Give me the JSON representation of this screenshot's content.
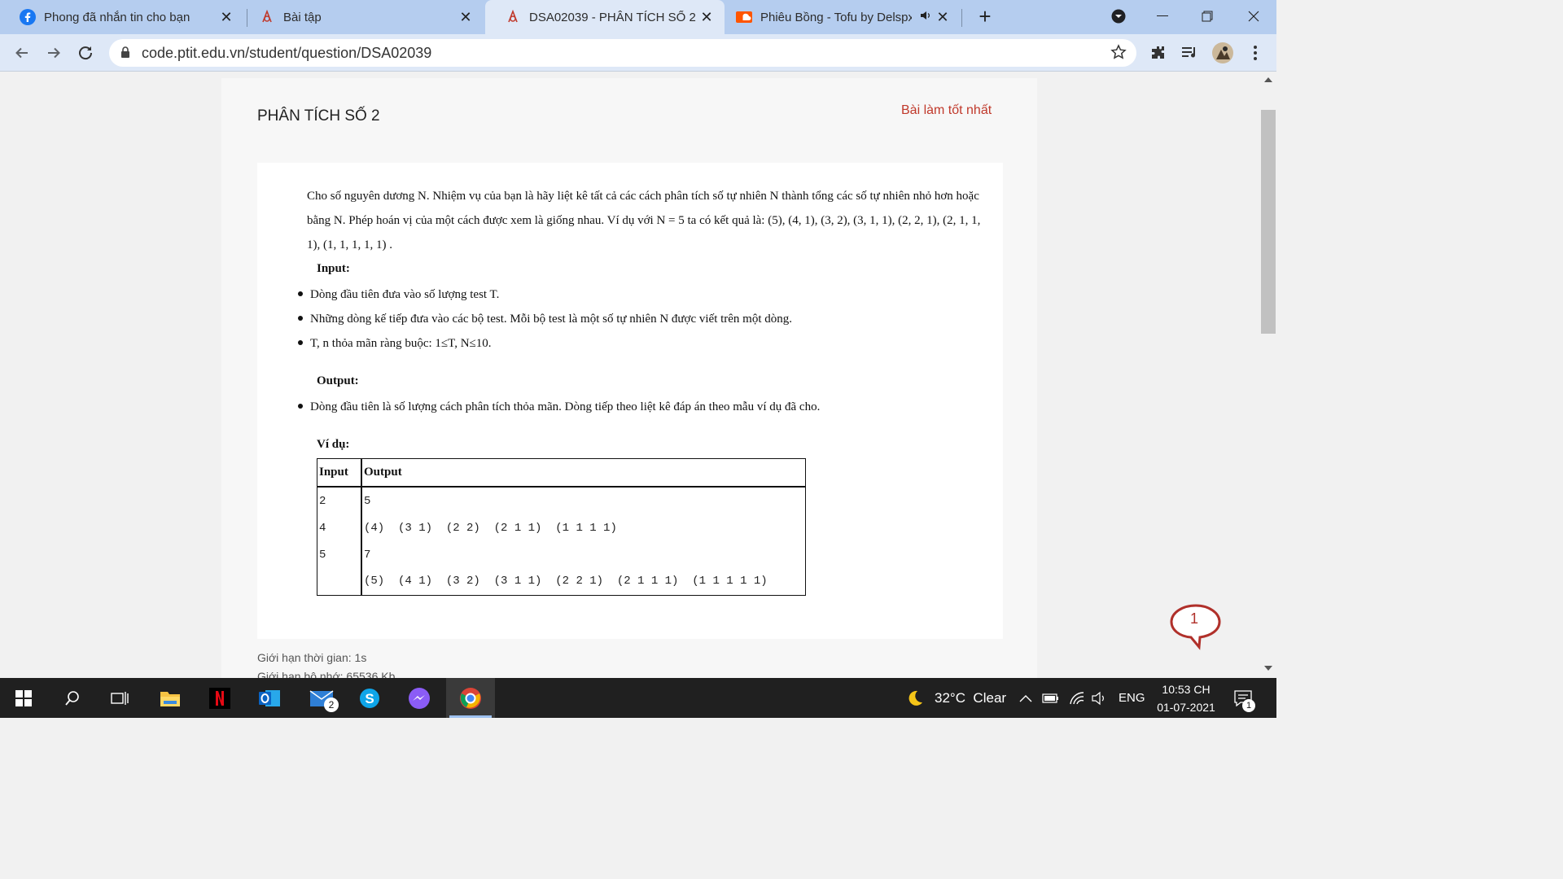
{
  "browser": {
    "tabs": [
      {
        "label": "Phong đã nhắn tin cho bạn",
        "icon": "facebook-icon"
      },
      {
        "label": "Bài tập",
        "icon": "ptit-code-icon"
      },
      {
        "label": "DSA02039 - PHÂN TÍCH SỐ 2",
        "icon": "ptit-code-icon"
      },
      {
        "label": "Phiêu Bồng - Tofu by Delspx",
        "icon": "soundcloud-icon"
      }
    ],
    "url": "code.ptit.edu.vn/student/question/DSA02039"
  },
  "problem": {
    "title": "PHÂN TÍCH SỐ 2",
    "best_link": "Bài làm tốt nhất",
    "description": "Cho số nguyên dương N. Nhiệm vụ của bạn là hãy liệt kê tất cả các cách phân tích số tự nhiên N thành tổng các số tự nhiên nhỏ hơn hoặc bằng N. Phép hoán vị của một cách được xem là giống nhau. Ví dụ với N = 5 ta có kết quả là: (5), (4, 1), (3, 2), (3, 1, 1), (2, 2, 1), (2, 1, 1, 1), (1, 1, 1, 1, 1) .",
    "input_heading": "Input:",
    "input_items": [
      "Dòng đầu tiên đưa vào số lượng test T.",
      "Những dòng kế tiếp đưa vào các bộ test. Mỗi bộ test là một số tự nhiên N được viết trên một dòng.",
      "T, n thỏa mãn ràng buộc: 1≤T, N≤10."
    ],
    "output_heading": "Output:",
    "output_items": [
      "Dòng đầu tiên là số lượng cách phân tích thỏa mãn. Dòng tiếp theo liệt kê đáp án theo mẫu ví dụ đã cho."
    ],
    "example_heading": "Ví dụ:",
    "example_table": {
      "headers": [
        "Input",
        "Output"
      ],
      "input_lines": [
        "2",
        "4",
        "5",
        ""
      ],
      "output_lines": [
        "5",
        "(4)  (3 1)  (2 2)  (2 1 1)  (1 1 1 1)",
        "7",
        "(5)  (4 1)  (3 2)  (3 1 1)  (2 2 1)  (2 1 1 1)  (1 1 1 1 1)"
      ]
    },
    "time_limit": "Giới hạn thời gian: 1s",
    "memory_limit": "Giới hạn bộ nhớ: 65536 Kb"
  },
  "chat_widget": {
    "badge": "1"
  },
  "taskbar": {
    "mail_badge": "2",
    "weather": "32°C  Clear",
    "language": "ENG",
    "time": "10:53 CH",
    "date": "01-07-2021",
    "notification_badge": "1"
  },
  "colors": {
    "accent": "#c0392b",
    "tabstrip": "#b5cdef",
    "toolbar": "#dee8f7",
    "taskbar": "#202020"
  }
}
